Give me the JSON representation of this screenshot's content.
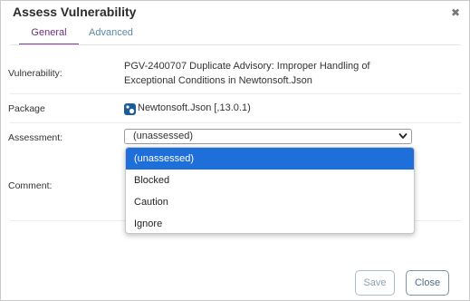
{
  "dialog": {
    "title": "Assess Vulnerability",
    "close_glyph": "✖"
  },
  "tabs": [
    {
      "label": "General",
      "active": true
    },
    {
      "label": "Advanced",
      "active": false
    }
  ],
  "fields": {
    "vulnerability_label": "Vulnerability:",
    "vulnerability_line1": "PGV-2400707 Duplicate Advisory: Improper Handling of",
    "vulnerability_line2": "Exceptional Conditions in Newtonsoft.Json",
    "package_label": "Package",
    "package_value": "Newtonsoft.Json [,13.0.1)",
    "package_icon": "nuget-package-icon",
    "assessment_label": "Assessment:",
    "assessment_value": "(unassessed)",
    "comment_label": "Comment:"
  },
  "assessment_options": [
    {
      "label": "(unassessed)",
      "selected": true
    },
    {
      "label": "Blocked",
      "selected": false
    },
    {
      "label": "Caution",
      "selected": false
    },
    {
      "label": "Ignore",
      "selected": false
    }
  ],
  "buttons": {
    "save_label": "Save",
    "close_label": "Close"
  },
  "colors": {
    "accent_tab": "#7b3f8d",
    "selected_option": "#1e6fd9",
    "link": "#5a8aa8"
  }
}
